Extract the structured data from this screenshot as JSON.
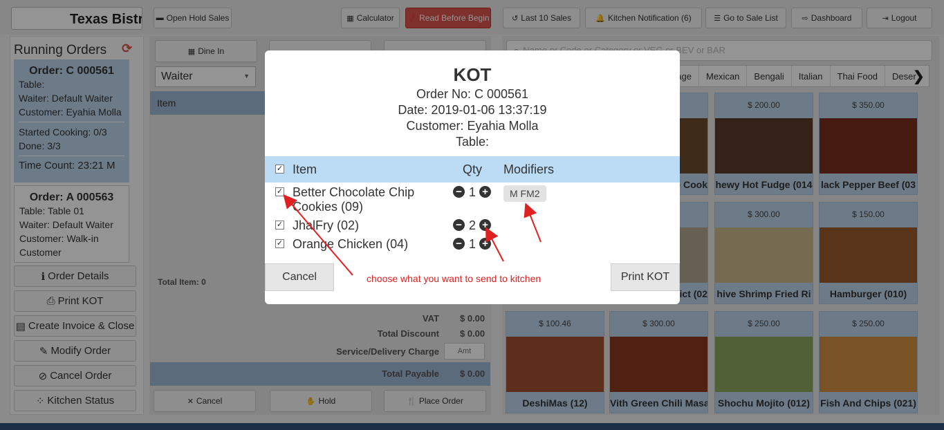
{
  "topbar": {
    "logo_text": "Texas Bistr",
    "open_hold_sales": "Open Hold Sales",
    "calculator": "Calculator",
    "read_before_begin": "Read Before Begin",
    "last_10_sales": "Last 10 Sales",
    "kitchen_notification": "Kitchen Notification (6)",
    "go_to_sale_list": "Go to Sale List",
    "dashboard": "Dashboard",
    "logout": "Logout"
  },
  "running_orders": {
    "title": "Running Orders",
    "orders": [
      {
        "no": "Order: C 000561",
        "table": "Table:",
        "waiter": "Waiter: Default Waiter",
        "customer": "Customer: Eyahia Molla",
        "started_cooking": "Started Cooking: 0/3",
        "done": "Done: 3/3",
        "time_count": "Time Count: 23:21 M"
      },
      {
        "no": "Order: A 000563",
        "table": "Table: Table 01",
        "waiter": "Waiter: Default Waiter",
        "customer": "Customer: Walk-in Customer"
      }
    ],
    "actions": {
      "order_details": "Order Details",
      "print_kot": "Print KOT",
      "create_invoice": "Create Invoice & Close",
      "modify_order": "Modify Order",
      "cancel_order": "Cancel Order",
      "kitchen_status": "Kitchen Status"
    }
  },
  "middle": {
    "dine_in": "Dine In",
    "waiter_select": "Waiter",
    "item_header": "Item",
    "total_item": "Total Item: 0",
    "vat_label": "VAT",
    "vat_value": "$ 0.00",
    "discount_label": "Total Discount",
    "discount_value": "$ 0.00",
    "service_label": "Service/Delivery Charge",
    "service_placeholder": "Amt",
    "payable_label": "Total Payable",
    "payable_value": "$ 0.00",
    "cancel": "Cancel",
    "hold": "Hold",
    "place_order": "Place Order"
  },
  "menu": {
    "search_placeholder": "Name or Code or Category or VEG or BEV or BAR",
    "categories": [
      "rage",
      "Mexican",
      "Bengali",
      "Italian",
      "Thai Food",
      "Deser"
    ],
    "items": [
      {
        "price": "",
        "name": "p Cook",
        "color": "#6b4a2e"
      },
      {
        "price": "$ 200.00",
        "name": "hewy Hot Fudge (014",
        "color": "#5a3a28"
      },
      {
        "price": "$ 350.00",
        "name": "lack Pepper Beef (03",
        "color": "#7a3020"
      },
      {
        "price": "",
        "name": "lict (02",
        "color": "#b0a890"
      },
      {
        "price": "$ 300.00",
        "name": "hive Shrimp Fried Ri",
        "color": "#c9b88a"
      },
      {
        "price": "$ 150.00",
        "name": "Hamburger (010)",
        "color": "#9a5a2a"
      },
      {
        "price": "$ 100.46",
        "name": "DeshiMas (12)",
        "color": "#a05030"
      },
      {
        "price": "$ 300.00",
        "name": "Vith Green Chili Masa",
        "color": "#8a3a20"
      },
      {
        "price": "$ 250.00",
        "name": "Shochu Mojito (012)",
        "color": "#8aa860"
      },
      {
        "price": "$ 250.00",
        "name": "Fish And Chips (021)",
        "color": "#d09040"
      }
    ]
  },
  "kot_modal": {
    "title": "KOT",
    "order_no": "Order No: C 000561",
    "date": "Date: 2019-01-06 13:37:19",
    "customer": "Customer: Eyahia Molla",
    "table": "Table:",
    "col_item": "Item",
    "col_qty": "Qty",
    "col_modifiers": "Modifiers",
    "items": [
      {
        "name": "Better Chocolate Chip Cookies (09)",
        "qty": "1",
        "modifier": "M FM2"
      },
      {
        "name": "JhalFry (02)",
        "qty": "2",
        "modifier": ""
      },
      {
        "name": "Orange Chicken (04)",
        "qty": "1",
        "modifier": ""
      }
    ],
    "cancel": "Cancel",
    "print_kot": "Print KOT",
    "note": "choose what you want to send to kitchen"
  }
}
